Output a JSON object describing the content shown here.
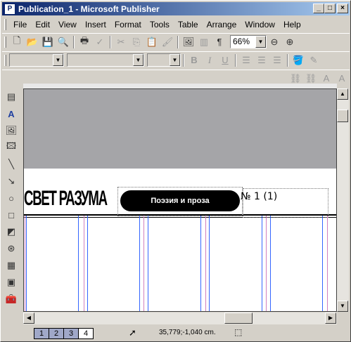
{
  "window": {
    "title": "Publication_1 - Microsoft Publisher",
    "app_icon_glyph": "P"
  },
  "menu": {
    "items": [
      "File",
      "Edit",
      "View",
      "Insert",
      "Format",
      "Tools",
      "Table",
      "Arrange",
      "Window",
      "Help"
    ]
  },
  "toolbar": {
    "zoom_value": "66%"
  },
  "document": {
    "masthead": "СВЕТ РАЗУМА",
    "pill_text": "Поэзия и проза",
    "issue_text": "№ 1 (1)"
  },
  "status": {
    "pages": [
      "1",
      "2",
      "3",
      "4"
    ],
    "active_page": "4",
    "coordinates": "35,779;-1,040 cm."
  },
  "colors": {
    "titlebar_start": "#0a246a",
    "titlebar_end": "#a6caf0",
    "canvas_bg": "#a5a5a8",
    "guide_blue": "#3366ff",
    "guide_pink": "#d080c0"
  }
}
